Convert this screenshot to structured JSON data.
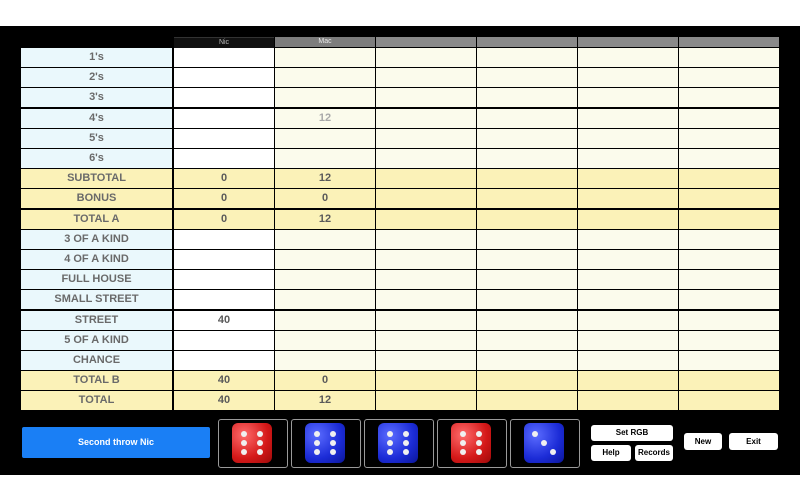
{
  "players": [
    "Nic",
    "Mac",
    "",
    "",
    "",
    ""
  ],
  "categories": [
    {
      "label": "1's",
      "type": "upper",
      "values": [
        "",
        ""
      ]
    },
    {
      "label": "2's",
      "type": "upper",
      "values": [
        "",
        ""
      ]
    },
    {
      "label": "3's",
      "type": "upper",
      "values": [
        "",
        ""
      ]
    },
    {
      "label": "4's",
      "type": "upper",
      "values": [
        "",
        "12"
      ],
      "ghost": [
        false,
        true
      ]
    },
    {
      "label": "5's",
      "type": "upper",
      "values": [
        "",
        ""
      ]
    },
    {
      "label": "6's",
      "type": "upper",
      "values": [
        "",
        ""
      ]
    },
    {
      "label": "SUBTOTAL",
      "type": "sum",
      "values": [
        "0",
        "12"
      ]
    },
    {
      "label": "BONUS",
      "type": "sum",
      "values": [
        "0",
        "0"
      ]
    },
    {
      "label": "TOTAL A",
      "type": "sum",
      "values": [
        "0",
        "12"
      ]
    },
    {
      "label": "3 OF A KIND",
      "type": "upper",
      "values": [
        "",
        ""
      ]
    },
    {
      "label": "4 OF A KIND",
      "type": "upper",
      "values": [
        "",
        ""
      ]
    },
    {
      "label": "FULL HOUSE",
      "type": "upper",
      "values": [
        "",
        ""
      ]
    },
    {
      "label": "SMALL STREET",
      "type": "upper",
      "values": [
        "",
        ""
      ]
    },
    {
      "label": "STREET",
      "type": "upper",
      "values": [
        "40",
        ""
      ]
    },
    {
      "label": "5 OF A KIND",
      "type": "upper",
      "values": [
        "",
        ""
      ]
    },
    {
      "label": "CHANCE",
      "type": "upper",
      "values": [
        "",
        ""
      ]
    },
    {
      "label": "TOTAL B",
      "type": "sum",
      "values": [
        "40",
        "0"
      ]
    },
    {
      "label": "TOTAL",
      "type": "sum",
      "values": [
        "40",
        "12"
      ]
    }
  ],
  "status": {
    "label": "Second throw Nic"
  },
  "dice": [
    {
      "color": "red",
      "face": 6
    },
    {
      "color": "blue",
      "face": 6
    },
    {
      "color": "blue",
      "face": 6
    },
    {
      "color": "red",
      "face": 6
    },
    {
      "color": "blue",
      "face": 3
    }
  ],
  "buttons": {
    "set_rgb": "Set RGB",
    "help": "Help",
    "records": "Records",
    "new": "New",
    "exit": "Exit"
  },
  "colors": {
    "label_bg": "#eaf8fc",
    "sum_bg": "#fbf2b8",
    "cell_bg": "#fdfdf8",
    "cell_alt_bg": "#fbfbec",
    "status_blue": "#1a7ff5"
  }
}
